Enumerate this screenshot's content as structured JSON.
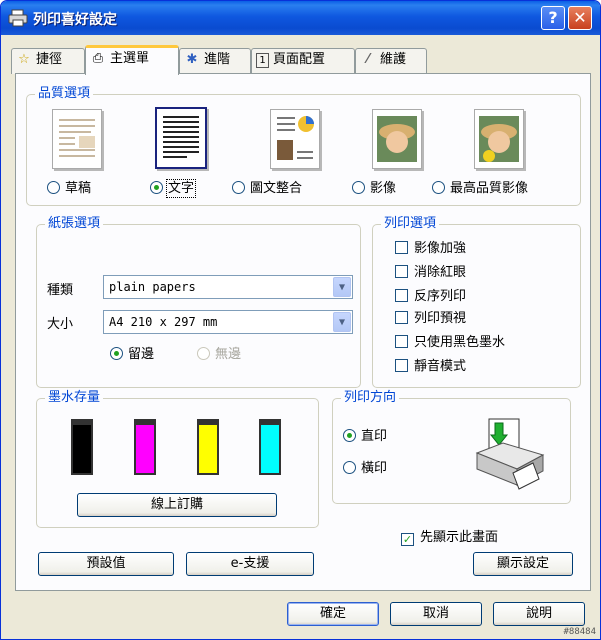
{
  "window": {
    "title": "列印喜好設定",
    "help_glyph": "?",
    "close_glyph": "✕"
  },
  "tabs": [
    {
      "label": "捷徑",
      "icon": "star-icon"
    },
    {
      "label": "主選單",
      "icon": "printer-icon"
    },
    {
      "label": "進階",
      "icon": "gear-icon"
    },
    {
      "label": "頁面配置",
      "icon": "page-icon"
    },
    {
      "label": "維護",
      "icon": "wrench-icon"
    }
  ],
  "tab_glyphs": {
    "star": "☆",
    "printer": "⎙",
    "gear": "✱",
    "page": "1",
    "wrench": "⁄"
  },
  "quality": {
    "title": "品質選項",
    "options": [
      {
        "label": "草稿",
        "selected": false
      },
      {
        "label": "文字",
        "selected": true
      },
      {
        "label": "圖文整合",
        "selected": false
      },
      {
        "label": "影像",
        "selected": false
      },
      {
        "label": "最高品質影像",
        "selected": false
      }
    ]
  },
  "paper": {
    "title": "紙張選項",
    "type_label": "種類",
    "type_value": "plain papers",
    "size_label": "大小",
    "size_value": "A4 210 x 297 mm",
    "margin_on": "留邊",
    "margin_off": "無邊",
    "arrow_glyph": "▼"
  },
  "print_options": {
    "title": "列印選項",
    "items": [
      {
        "label": "影像加強",
        "checked": false
      },
      {
        "label": "消除紅眼",
        "checked": false
      },
      {
        "label": "反序列印",
        "checked": false
      },
      {
        "label": "列印預視",
        "checked": false
      },
      {
        "label": "只使用黑色墨水",
        "checked": false
      },
      {
        "label": "靜音模式",
        "checked": false
      }
    ]
  },
  "ink": {
    "title": "墨水存量",
    "colors": [
      "#000000",
      "#ff00ff",
      "#ffff00",
      "#00ffff"
    ],
    "buy_label": "線上訂購"
  },
  "orientation": {
    "title": "列印方向",
    "portrait": "直印",
    "landscape": "橫印"
  },
  "show_screen": {
    "label": "先顯示此畫面",
    "checked": true,
    "check_glyph": "✓"
  },
  "buttons": {
    "defaults": "預設值",
    "support": "e-支援",
    "show_settings": "顯示設定",
    "ok": "確定",
    "cancel": "取消",
    "help": "說明"
  },
  "watermark": "#88484"
}
